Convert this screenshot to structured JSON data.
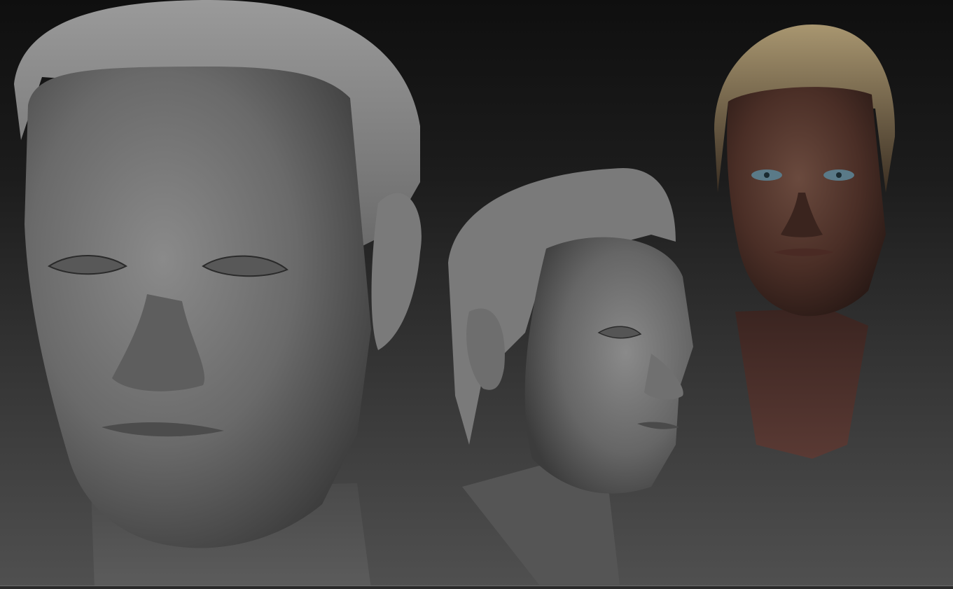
{
  "viewport": {
    "models": [
      {
        "name": "sculpt-head-front",
        "material": "matcap-gray"
      },
      {
        "name": "sculpt-head-three-quarter",
        "material": "matcap-gray"
      },
      {
        "name": "textured-head-front",
        "material": "skin-texture"
      }
    ],
    "colors": {
      "background_top": "#0f0f0f",
      "background_bottom": "#505050",
      "sculpt_gray": "#6e6e6e",
      "skin": "#5a3a30",
      "hair": "#8a7a5a"
    }
  }
}
